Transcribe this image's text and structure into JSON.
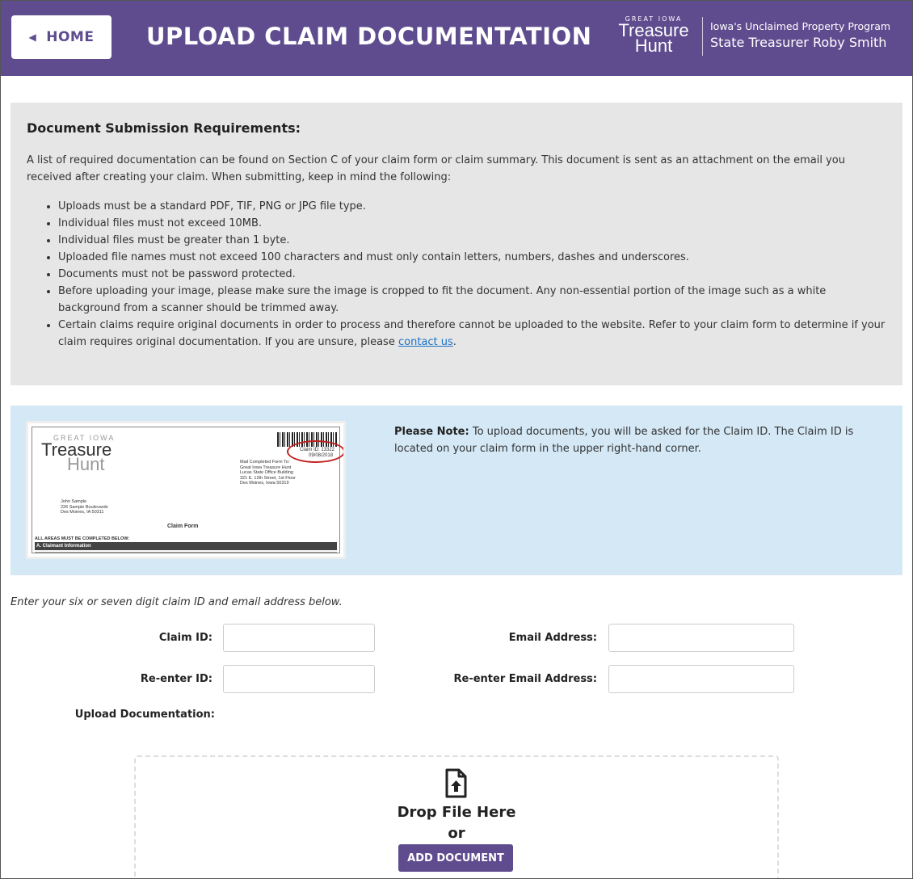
{
  "header": {
    "home_label": "HOME",
    "title": "UPLOAD CLAIM DOCUMENTATION",
    "logo_small": "GREAT IOWA",
    "logo_line1": "Treasure",
    "logo_line2": "Hunt",
    "program": "Iowa's Unclaimed Property Program",
    "treasurer": "State Treasurer Roby Smith",
    "bg_color": "#5f4c8f"
  },
  "requirements": {
    "heading": "Document Submission Requirements:",
    "intro": "A list of required documentation can be found on Section C of your claim form or claim summary. This document is sent as an attachment on the email you received after creating your claim. When submitting, keep in mind the following:",
    "items": [
      "Uploads must be a standard PDF, TIF, PNG or JPG file type.",
      "Individual files must not exceed 10MB.",
      "Individual files must be greater than 1 byte.",
      "Uploaded file names must not exceed 100 characters and must only contain letters, numbers, dashes and underscores.",
      "Documents must not be password protected.",
      "Before uploading your image, please make sure the image is cropped to fit the document. Any non-essential portion of the image such as a white background from a scanner should be trimmed away.",
      "Certain claims require original documents in order to process and therefore cannot be uploaded to the website. Refer to your claim form to determine if your claim requires original documentation. If you are unsure, please"
    ],
    "contact_link": "contact us",
    "contact_tail": "."
  },
  "note": {
    "bold": "Please Note:",
    "text": " To upload documents, you will be asked for the Claim ID. The Claim ID is located on your claim form in the upper right-hand corner."
  },
  "claim_image": {
    "logo_small": "GREAT IOWA",
    "logo_line1": "Treasure",
    "logo_line2": "Hunt",
    "claim_id": "Claim ID: 13322",
    "date": "09/08/2018",
    "mail_to": "Mail Completed Form To:\nGreat Iowa Treasure Hunt\nLucas State Office Building\n321 E. 12th Street, 1st Floor\nDes Moines, Iowa 50319",
    "address": "John Sample\n226 Sample Boulevarde\nDes Moines, IA 50311",
    "form_title": "Claim Form",
    "areas_note": "ALL AREAS MUST BE COMPLETED BELOW:",
    "section_a": "A. Claimant Information"
  },
  "form": {
    "instructions": "Enter your six or seven digit claim ID and email address below.",
    "claim_id_label": "Claim ID:",
    "reenter_id_label": "Re-enter ID:",
    "email_label": "Email Address:",
    "reenter_email_label": "Re-enter Email Address:",
    "upload_label": "Upload Documentation:",
    "claim_id_value": "",
    "reenter_id_value": "",
    "email_value": "",
    "reenter_email_value": ""
  },
  "dropzone": {
    "drop_text": "Drop File Here",
    "or_text": "or",
    "button": "ADD DOCUMENT",
    "icon": "file-upload-icon"
  }
}
